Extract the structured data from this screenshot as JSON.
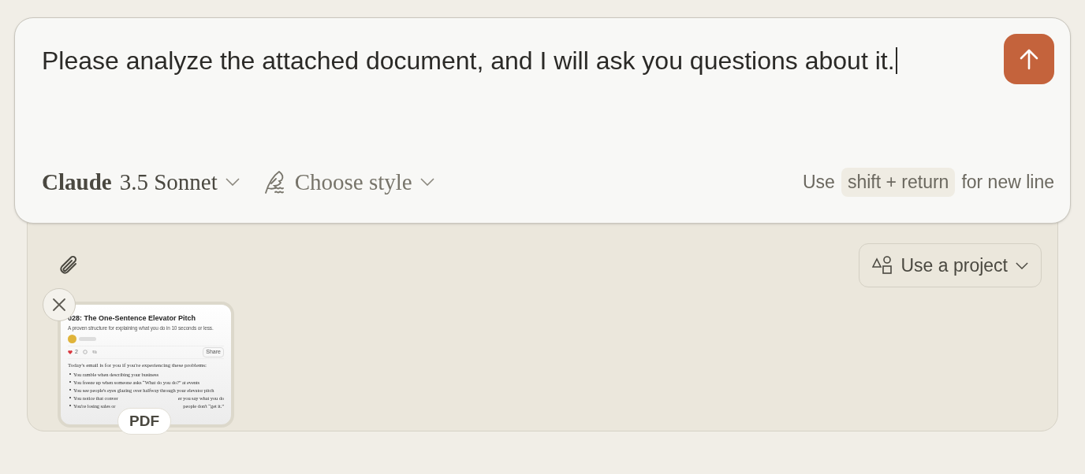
{
  "message": {
    "value": "Please analyze the attached document, and I will ask you questions about it."
  },
  "model_selector": {
    "name": "Claude",
    "version": "3.5 Sonnet"
  },
  "style_selector": {
    "label": "Choose style"
  },
  "hint": {
    "prefix": "Use",
    "key": "shift + return",
    "suffix": "for new line"
  },
  "project_button": {
    "label": "Use a project"
  },
  "attachments": [
    {
      "kind": "pdf",
      "badge": "PDF",
      "document": {
        "title": "028: The One-Sentence Elevator Pitch",
        "subtitle": "A proven structure for explaining what you do in 10 seconds or less.",
        "likes": "2",
        "share": "Share",
        "intro": "Today's email is for you if you're experiencing these problems:",
        "bullets": [
          {
            "parts": [
              "You ramble when describing your business"
            ]
          },
          {
            "parts": [
              "You freeze up when someone asks “What do you do?” at events"
            ]
          },
          {
            "parts": [
              "You see people's eyes glazing over halfway through your elevator pitch"
            ]
          },
          {
            "parts": [
              "You notice that conver",
              "er you say what you do"
            ]
          },
          {
            "parts": [
              "You're losing sales or",
              "people don't “get it.”"
            ]
          }
        ]
      }
    }
  ]
}
